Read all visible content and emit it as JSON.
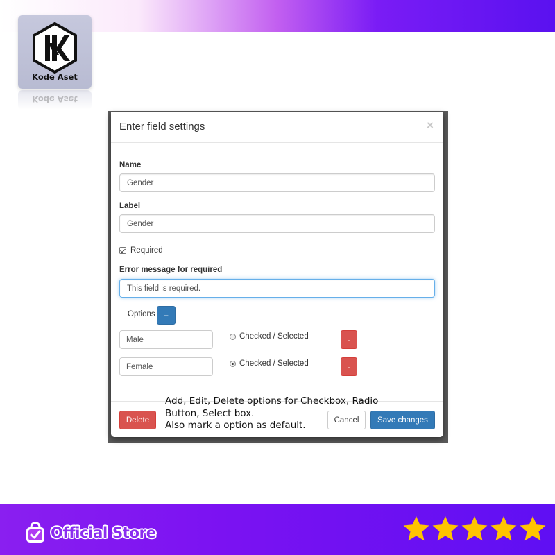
{
  "brand": {
    "logo_text": "Kode Aset"
  },
  "dialog": {
    "title": "Enter field settings",
    "close_glyph": "×",
    "name": {
      "label": "Name",
      "value": "Gender"
    },
    "label_field": {
      "label": "Label",
      "value": "Gender"
    },
    "required": {
      "label": "Required",
      "checked": true
    },
    "error_message": {
      "label": "Error message for required",
      "value": "This field is required."
    },
    "options": {
      "label": "Options",
      "add_label": "+",
      "items": [
        {
          "value": "Male",
          "toggle_label": "Checked / Selected",
          "checked": false,
          "remove_label": "-"
        },
        {
          "value": "Female",
          "toggle_label": "Checked / Selected",
          "checked": true,
          "remove_label": "-"
        }
      ]
    },
    "footer": {
      "delete_label": "Delete",
      "cancel_label": "Cancel",
      "save_label": "Save changes"
    }
  },
  "caption": {
    "line1": "Add, Edit, Delete options for Checkbox, Radio",
    "line2": "Button, Select box.",
    "line3": "Also mark a option as default."
  },
  "store": {
    "label": "Official Store",
    "rating": 5,
    "star_color": "#ffc400"
  },
  "colors": {
    "primary": "#337ab7",
    "danger": "#d9534f",
    "band_purple": "#6a12f2"
  }
}
